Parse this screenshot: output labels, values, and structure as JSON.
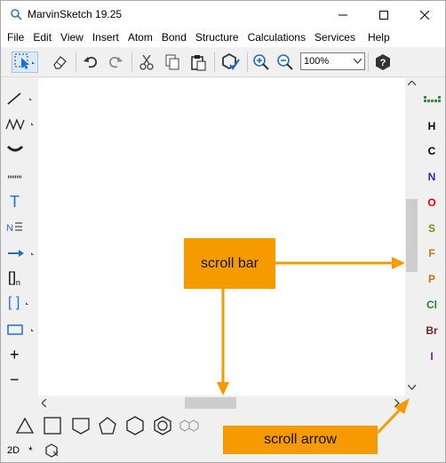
{
  "window": {
    "title": "MarvinSketch 19.25"
  },
  "menu": [
    "File",
    "Edit",
    "View",
    "Insert",
    "Atom",
    "Bond",
    "Structure",
    "Calculations",
    "Services",
    "Help"
  ],
  "toolbar": {
    "zoom": "100%"
  },
  "left_tools": {
    "text_tool": "T",
    "bracket_tool": "[]",
    "bracket_subscript": "n",
    "square_bracket_tool": "[ ]",
    "plus_tool": "+",
    "minus_tool": "−"
  },
  "elements": [
    {
      "symbol": "H",
      "color": "#000000"
    },
    {
      "symbol": "C",
      "color": "#000000"
    },
    {
      "symbol": "N",
      "color": "#2b2bb8"
    },
    {
      "symbol": "O",
      "color": "#e00000"
    },
    {
      "symbol": "S",
      "color": "#8a8a00"
    },
    {
      "symbol": "F",
      "color": "#c07800"
    },
    {
      "symbol": "P",
      "color": "#c07800"
    },
    {
      "symbol": "Cl",
      "color": "#1f8a1f"
    },
    {
      "symbol": "Br",
      "color": "#7a1f1f"
    },
    {
      "symbol": "I",
      "color": "#7a1f9a"
    }
  ],
  "status": {
    "mode": "2D",
    "star": "*"
  },
  "annotations": {
    "scroll_bar": "scroll bar",
    "scroll_arrow": "scroll arrow"
  },
  "colors": {
    "callout": "#f59b00",
    "accent_blue": "#1c6fd1"
  }
}
